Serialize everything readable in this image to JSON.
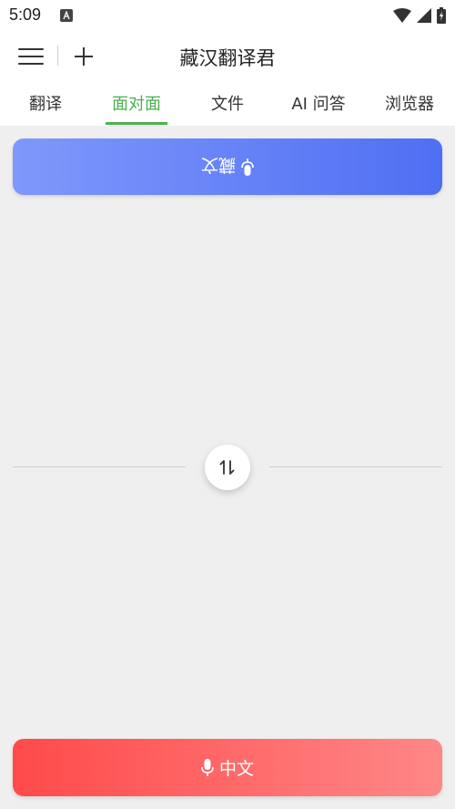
{
  "status_bar": {
    "time": "5:09"
  },
  "app_bar": {
    "title": "藏汉翻译君"
  },
  "tabs": [
    {
      "label": "翻译"
    },
    {
      "label": "面对面"
    },
    {
      "label": "文件"
    },
    {
      "label": "AI 问答"
    },
    {
      "label": "浏览器"
    }
  ],
  "active_tab": "面对面",
  "conversation": {
    "top_button_label": "藏文",
    "bottom_button_label": "中文"
  },
  "icons": {
    "menu": "hamburger-menu-icon",
    "add": "plus-icon",
    "microphone": "microphone-icon",
    "swap": "swap-vertical-icon"
  },
  "colors": {
    "active_tab": "#4CAF50",
    "top_button_start": "#7f98fb",
    "top_button_end": "#4f6ff3",
    "bottom_button_start": "#ff4a4a",
    "bottom_button_end": "#ff8787"
  }
}
